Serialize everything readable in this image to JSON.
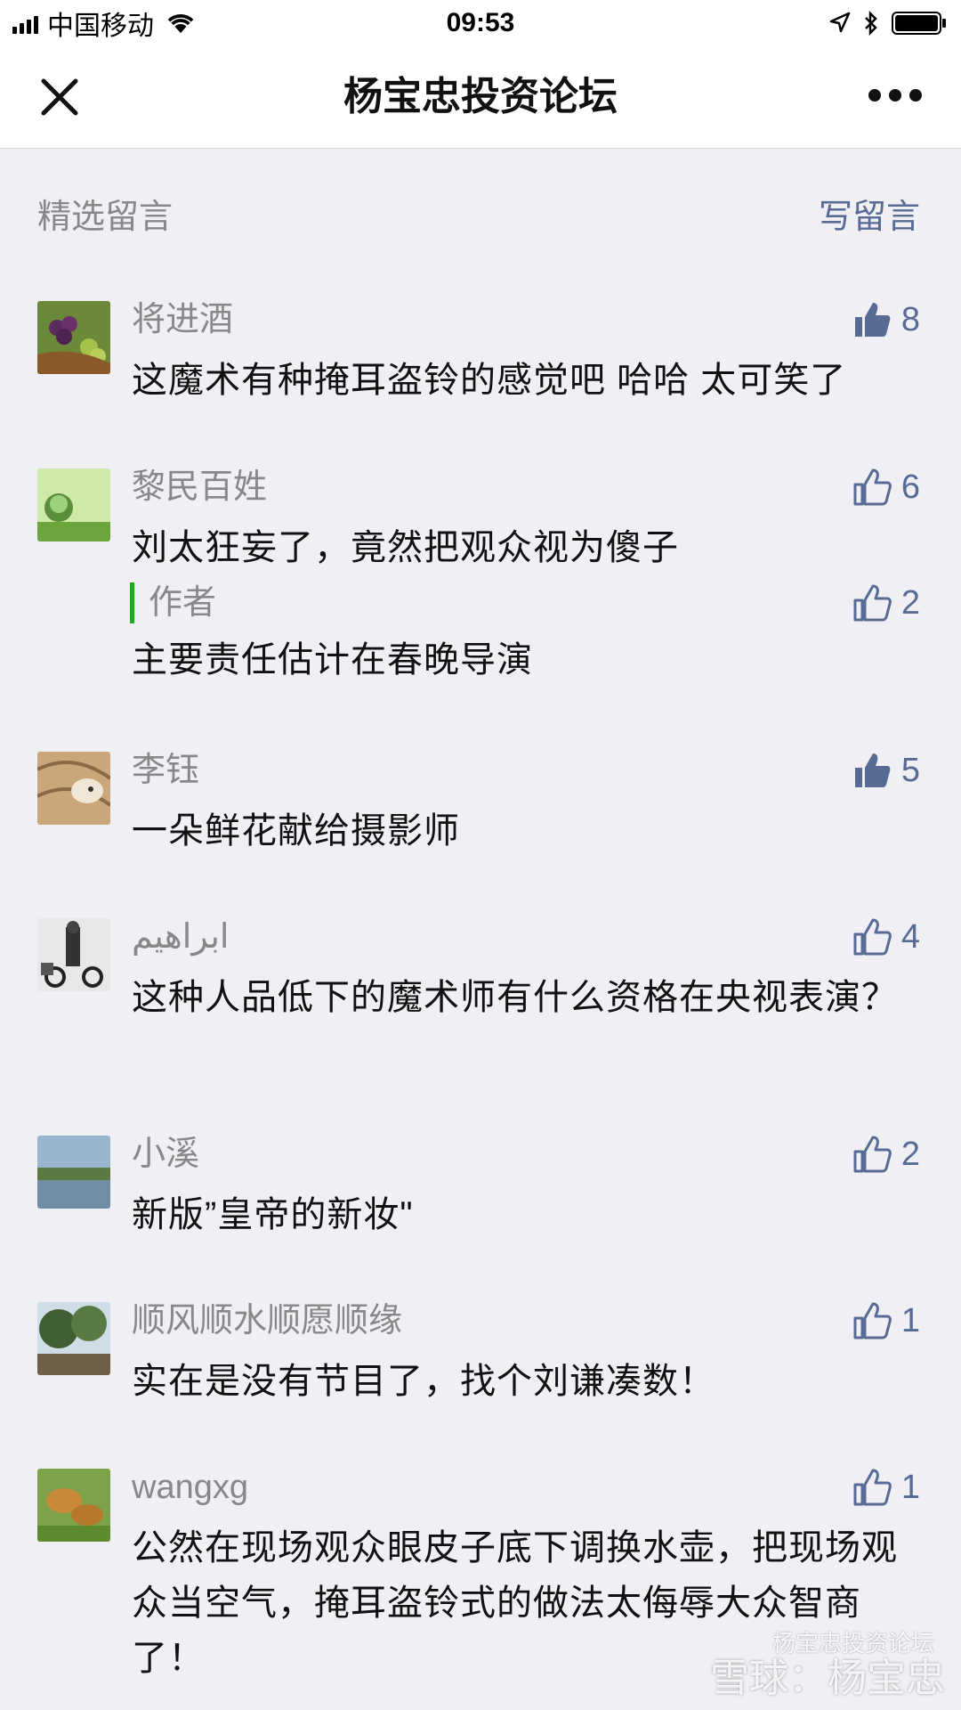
{
  "status_bar": {
    "carrier": "中国移动",
    "time": "09:53"
  },
  "nav": {
    "title": "杨宝忠投资论坛"
  },
  "section": {
    "title": "精选留言",
    "write_label": "写留言"
  },
  "comments": [
    {
      "nickname": "将进酒",
      "text": "这魔术有种掩耳盗铃的感觉吧 哈哈 太可笑了",
      "likes": "8",
      "liked": true
    },
    {
      "nickname": "黎民百姓",
      "text": "刘太狂妄了，竟然把观众视为傻子",
      "likes": "6",
      "liked": false,
      "reply": {
        "label": "作者",
        "text": "主要责任估计在春晚导演",
        "likes": "2"
      }
    },
    {
      "nickname": "李钰",
      "text": "一朵鲜花献给摄影师",
      "likes": "5",
      "liked": true
    },
    {
      "nickname": "ابراهيم",
      "text": "这种人品低下的魔术师有什么资格在央视表演？",
      "likes": "4",
      "liked": false
    },
    {
      "nickname": "小溪",
      "text": "新版”皇帝的新妆\"",
      "likes": "2",
      "liked": false
    },
    {
      "nickname": "顺风顺水顺愿顺缘",
      "text": "实在是没有节目了，找个刘谦凑数！",
      "likes": "1",
      "liked": false
    },
    {
      "nickname": "wangxg",
      "text": "公然在现场观众眼皮子底下调换水壶，把现场观众当空气，掩耳盗铃式的做法太侮辱大众智商了！",
      "likes": "1",
      "liked": false
    }
  ],
  "watermark": {
    "line1": "杨宝忠投资论坛",
    "line2": "雪球：杨宝忠"
  },
  "colors": {
    "link": "#576b95",
    "author_bar": "#1aad19",
    "background": "#efeff4"
  }
}
